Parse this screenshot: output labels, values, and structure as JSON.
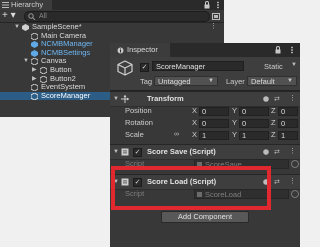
{
  "hierarchy": {
    "tab_label": "Hierarchy",
    "add_button": "+ ▾",
    "search_placeholder": "All",
    "items": [
      {
        "label": "SampleScene*",
        "depth": 0,
        "expanded": true
      },
      {
        "label": "Main Camera",
        "depth": 1
      },
      {
        "label": "NCMBManager",
        "depth": 1,
        "prefab": true
      },
      {
        "label": "NCMBSettings",
        "depth": 1,
        "prefab": true
      },
      {
        "label": "Canvas",
        "depth": 1,
        "expanded": true
      },
      {
        "label": "Button",
        "depth": 2,
        "collapsed": true
      },
      {
        "label": "Button2",
        "depth": 2,
        "collapsed": true
      },
      {
        "label": "EventSystem",
        "depth": 1
      },
      {
        "label": "ScoreManager",
        "depth": 1,
        "selected": true
      }
    ]
  },
  "inspector": {
    "tab_label": "Inspector",
    "object_name": "ScoreManager",
    "active_checked": "✓",
    "static_label": "Static",
    "tag_label": "Tag",
    "tag_value": "Untagged",
    "layer_label": "Layer",
    "layer_value": "Default",
    "transform": {
      "title": "Transform",
      "rows": [
        {
          "label": "Position",
          "x": "0",
          "y": "0",
          "z": "0"
        },
        {
          "label": "Rotation",
          "x": "0",
          "y": "0",
          "z": "0"
        },
        {
          "label": "Scale",
          "x": "1",
          "y": "1",
          "z": "1"
        }
      ],
      "axis_x": "X",
      "axis_y": "Y",
      "axis_z": "Z"
    },
    "score_save": {
      "title": "Score Save (Script)",
      "script_label": "Script",
      "script_value": "ScoreSave"
    },
    "score_load": {
      "title": "Score Load (Script)",
      "script_label": "Script",
      "script_value": "ScoreLoad"
    },
    "add_component": "Add Component"
  },
  "colors": {
    "highlight": "#e0282e",
    "selected_row": "#2c5d87",
    "prefab_text": "#6fb9f5"
  }
}
